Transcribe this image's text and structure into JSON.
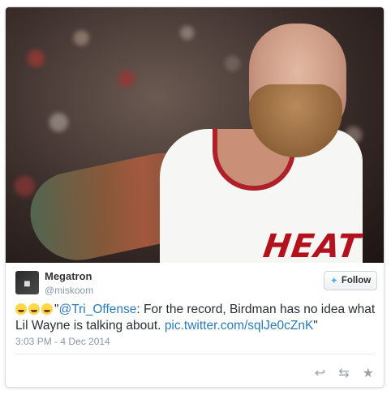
{
  "tweet": {
    "display_name": "Megatron",
    "handle": "@miskoom",
    "follow_label": "Follow",
    "text_quote_open": "\"",
    "mention": "@Tri_Offense",
    "text_body": ": For the record, Birdman has no idea what Lil Wayne is talking about. ",
    "media_link": "pic.twitter.com/sqlJe0cZnK",
    "text_quote_close": "\"",
    "emoji_count": 3,
    "timestamp": "3:03 PM - 4 Dec 2014"
  },
  "photo": {
    "jersey_text": "HEAT"
  },
  "icons": {
    "follow": "twitter-bird-icon",
    "actions": [
      "reply-icon",
      "retweet-icon",
      "favorite-icon"
    ]
  },
  "colors": {
    "link": "#2b7bb9",
    "muted": "#8899a6",
    "bird": "#55acee",
    "jersey_red": "#b3121d"
  }
}
